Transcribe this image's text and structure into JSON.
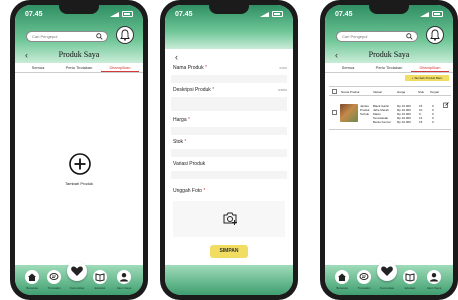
{
  "status": {
    "time": "07.45"
  },
  "search": {
    "placeholder": "Cari Pengepul"
  },
  "product_page": {
    "title": "Produk Saya",
    "tabs": [
      {
        "label": "Semua"
      },
      {
        "label": "Perlu Tindakan"
      },
      {
        "label": "Ditampilkan"
      }
    ],
    "add_product_label": "Tambah Produk"
  },
  "nav": {
    "items": [
      {
        "label": "Beranda",
        "icon": "home-icon"
      },
      {
        "label": "Transaksi",
        "icon": "chat-icon"
      },
      {
        "label": "Komunitas",
        "icon": "heart-hands-icon"
      },
      {
        "label": "Edukasi",
        "icon": "book-icon"
      },
      {
        "label": "Akun Saya",
        "icon": "user-icon"
      }
    ]
  },
  "form": {
    "fields": [
      {
        "label": "Nama Produk",
        "required": "*",
        "counter": "0/200"
      },
      {
        "label": "Deskripsi Produk",
        "required": "*",
        "counter": "0/3000"
      },
      {
        "label": "Harga",
        "required": "*"
      },
      {
        "label": "Stok",
        "required": "*"
      },
      {
        "label": "Variasi Produk",
        "required": ""
      },
      {
        "label": "Unggah Foto",
        "required": "*"
      }
    ],
    "save_label": "SIMPAN"
  },
  "table": {
    "add_button": "+ Tambah Produk Baru",
    "headers": [
      "Nama Produk",
      "Variasi",
      "Harga",
      "Stok",
      "Terjual"
    ],
    "rows": [
      {
        "name": "Jambu Produk Terbuk",
        "variants": [
          "Black Garlic",
          "Jahe Merah",
          "Madu",
          "Temulawak",
          "Beras Kencur"
        ],
        "prices": [
          "Rp 15.000",
          "Rp 10.000",
          "Rp 15.000",
          "Rp 10.000",
          "Rp 10.000"
        ],
        "stocks": [
          "15",
          "10",
          "9",
          "12",
          "15"
        ],
        "sold": [
          "0",
          "0",
          "0",
          "0",
          "0"
        ]
      }
    ]
  },
  "colors": {
    "accent": "#2f8f63",
    "active_tab": "#d23b3b",
    "button": "#f2dd63"
  }
}
